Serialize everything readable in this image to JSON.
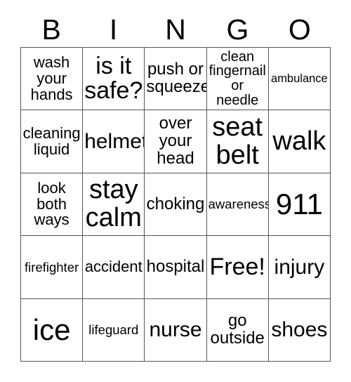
{
  "card": {
    "title": "BINGO",
    "header_letters": [
      "B",
      "I",
      "N",
      "G",
      "O"
    ],
    "columns": 5,
    "rows": 5,
    "free_space_label": "Free!",
    "free_space_position": {
      "row": 4,
      "col": 4
    },
    "border_color": "#555555",
    "text_color": "#000000",
    "background_color": "#ffffff",
    "cells": [
      [
        {
          "text": "wash\nyour\nhands",
          "size": "md"
        },
        {
          "text": "is it\nsafe?",
          "size": "xxl"
        },
        {
          "text": "push or\nsqueeze",
          "size": "mdl"
        },
        {
          "text": "clean\nfingernail\nor needle",
          "size": "smm"
        },
        {
          "text": "ambulance",
          "size": "xs"
        }
      ],
      [
        {
          "text": "cleaning\nliquid",
          "size": "md"
        },
        {
          "text": "helmet",
          "size": "xl"
        },
        {
          "text": "over\nyour\nhead",
          "size": "mdl"
        },
        {
          "text": "seat\nbelt",
          "size": "huge"
        },
        {
          "text": "walk",
          "size": "huge"
        }
      ],
      [
        {
          "text": "look\nboth\nways",
          "size": "md"
        },
        {
          "text": "stay\ncalm",
          "size": "huge"
        },
        {
          "text": "choking",
          "size": "mdl"
        },
        {
          "text": "awareness",
          "size": "sm"
        },
        {
          "text": "911",
          "size": "mega"
        }
      ],
      [
        {
          "text": "firefighter",
          "size": "sm"
        },
        {
          "text": "accident",
          "size": "md"
        },
        {
          "text": "hospital",
          "size": "mdl"
        },
        {
          "text": "Free!",
          "size": "xxl"
        },
        {
          "text": "injury",
          "size": "xl"
        }
      ],
      [
        {
          "text": "ice",
          "size": "mega"
        },
        {
          "text": "lifeguard",
          "size": "sm"
        },
        {
          "text": "nurse",
          "size": "xl"
        },
        {
          "text": "go\noutside",
          "size": "mdl"
        },
        {
          "text": "shoes",
          "size": "xl"
        }
      ]
    ]
  }
}
